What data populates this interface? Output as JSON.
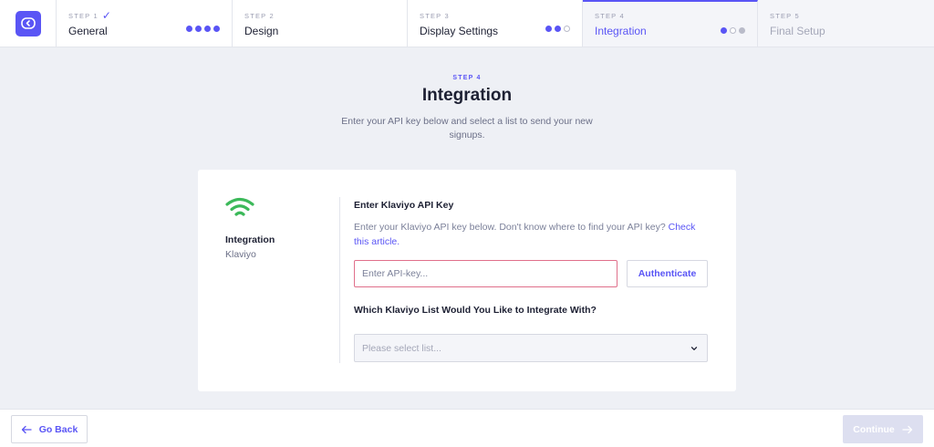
{
  "stepper": {
    "steps": [
      {
        "num": "STEP 1",
        "name": "General",
        "done": true,
        "dots": "filled,filled,filled,filled"
      },
      {
        "num": "STEP 2",
        "name": "Design"
      },
      {
        "num": "STEP 3",
        "name": "Display Settings",
        "dots": "filled,filled,empty"
      },
      {
        "num": "STEP 4",
        "name": "Integration",
        "dots": "filled,empty,grey",
        "active": true
      },
      {
        "num": "STEP 5",
        "name": "Final Setup",
        "disabled": true
      }
    ],
    "check_glyph": "✓"
  },
  "header": {
    "step_label": "STEP 4",
    "title": "Integration",
    "subtitle": "Enter your API key below and select a list to send your new signups."
  },
  "card": {
    "icon": "wifi-icon",
    "integration_title": "Integration",
    "integration_name": "Klaviyo",
    "api_key_label": "Enter Klaviyo API Key",
    "help_text": "Enter your Klaviyo API key below. Don't know where to find your API key?",
    "help_link": "Check this article.",
    "api_key_placeholder": "Enter API-key...",
    "api_key_value": "",
    "authenticate_label": "Authenticate",
    "list_label": "Which Klaviyo List Would You Like to Integrate With?",
    "list_placeholder": "Please select list..."
  },
  "footer": {
    "back_label": "Go Back",
    "continue_label": "Continue"
  },
  "colors": {
    "accent": "#5a55f5",
    "wifi_green": "#3cb95a",
    "error_border": "#e0708b",
    "continue_disabled": "#dddff0"
  }
}
